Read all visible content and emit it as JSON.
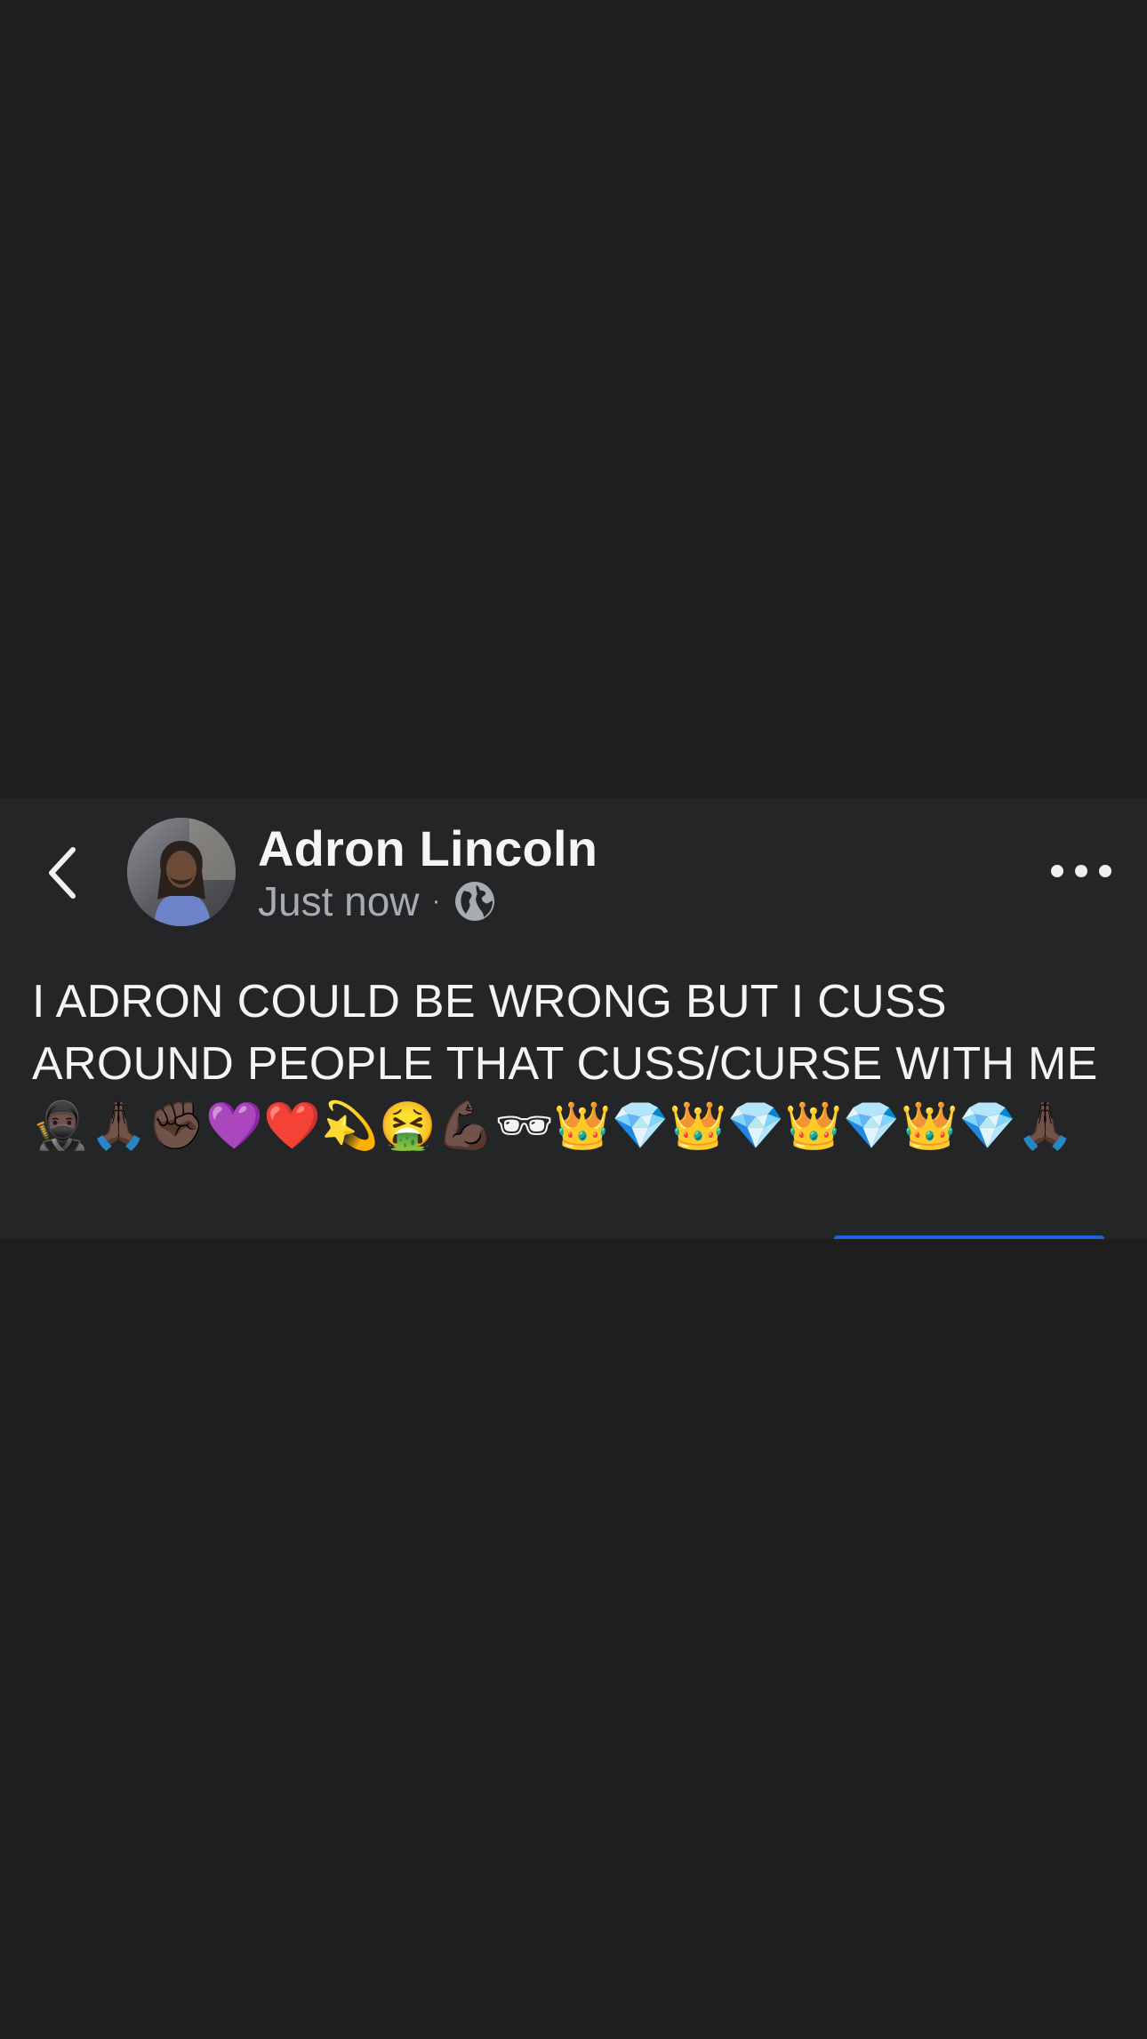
{
  "post": {
    "author_name": "Adron Lincoln",
    "timestamp": "Just now",
    "meta_separator": "·",
    "visibility_icon": "globe-icon",
    "text": "I ADRON COULD BE WRONG BUT I CUSS AROUND PEOPLE THAT CUSS/CURSE WITH ME",
    "emojis": "🥷🏿🙏🏿✊🏿💜❤️💫🤮💪🏿🕶👑💎👑💎👑💎👑💎🙏🏿"
  },
  "icons": {
    "back": "chevron-left-icon",
    "more": "more-horizontal-icon",
    "avatar": "avatar"
  },
  "colors": {
    "background": "#1e1e1e",
    "card": "#242526",
    "primary_text": "#f4f4f4",
    "secondary_text": "#a8abaf",
    "accent": "#1b66e0"
  }
}
